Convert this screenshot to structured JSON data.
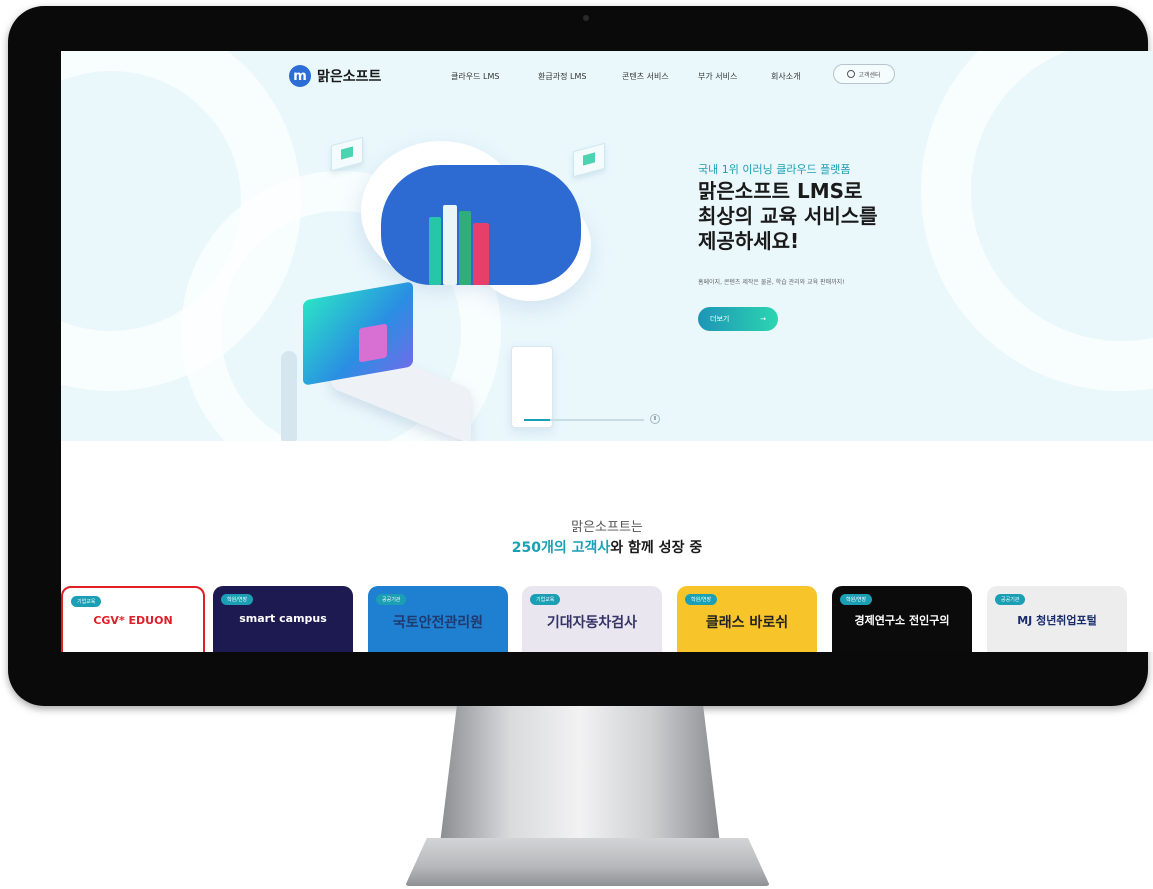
{
  "header": {
    "logo_mark": "m",
    "logo_text": "맑은소프트",
    "nav": [
      "클라우드 LMS",
      "환급과정 LMS",
      "콘텐츠 서비스",
      "부가 서비스",
      "회사소개"
    ],
    "support_label": "고객센터"
  },
  "hero": {
    "subtitle": "국내 1위 이러닝 클라우드 플랫폼",
    "title_line1": "맑은소프트 LMS로",
    "title_line2": "최상의 교육 서비스를",
    "title_line3": "제공하세요!",
    "description": "홈페이지, 콘텐츠 제작은 물론, 학습 관리와 교육 판매까지!",
    "more_label": "더보기",
    "more_arrow": "→",
    "slide_progress": 0.22,
    "pause_icon": "II"
  },
  "clients": {
    "lead": "맑은소프트는",
    "title_highlight": "250개의 고객사",
    "title_rest": "와 함께 성장 중",
    "cards": [
      {
        "badge": "기업교육",
        "logo": "CGV* EDUON",
        "bg": "#ffffff",
        "fg": "#e01e26"
      },
      {
        "badge": "학원/연장",
        "logo": "smart campus",
        "bg": "#1d1a52",
        "fg": "#ffffff"
      },
      {
        "badge": "공공기관",
        "logo": "국토안전관리원",
        "bg": "#1f7fd1",
        "fg": "#1e3a6e"
      },
      {
        "badge": "기업교육",
        "logo": "기대자동차검사",
        "bg": "#e9e6ef",
        "fg": "#333366"
      },
      {
        "badge": "학원/연장",
        "logo": "클래스 바로쉬",
        "bg": "#f7c52a",
        "fg": "#222222"
      },
      {
        "badge": "학원/연장",
        "logo": "경제연구소 전인구의",
        "bg": "#0b0b0b",
        "fg": "#ffffff"
      },
      {
        "badge": "공공기관",
        "logo": "MJ 청년취업포털",
        "bg": "#ededed",
        "fg": "#1a2d6b"
      }
    ]
  }
}
